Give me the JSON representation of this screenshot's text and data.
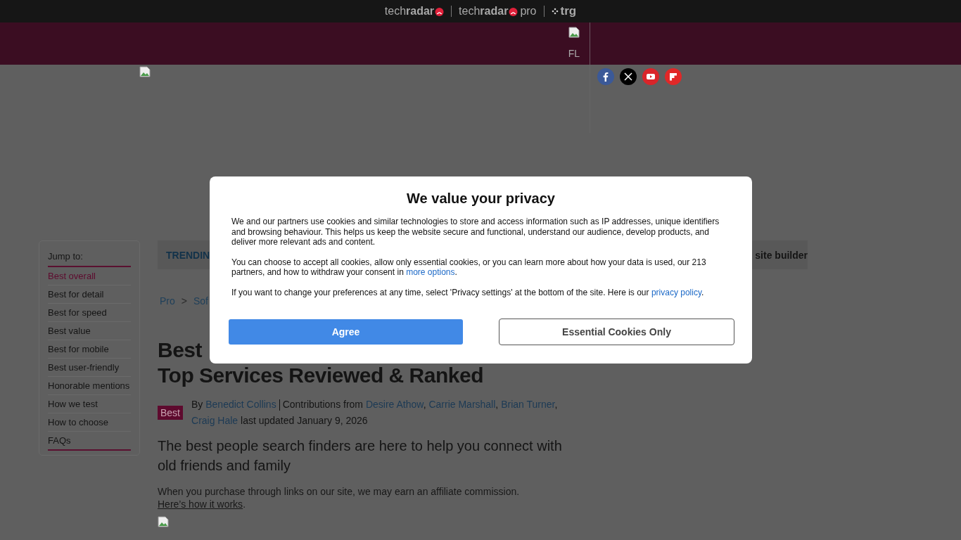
{
  "top_bar": {
    "brands": [
      {
        "kind": "techradar",
        "name": "tech",
        "bold": "radar"
      },
      {
        "kind": "pro",
        "name": "tech",
        "bold": "radar",
        "suffix": "pro"
      },
      {
        "kind": "trg",
        "name": "trg"
      }
    ]
  },
  "header": {
    "image_alt": "FL"
  },
  "social": [
    {
      "kind": "facebook"
    },
    {
      "kind": "x"
    },
    {
      "kind": "youtube"
    },
    {
      "kind": "flipboard"
    }
  ],
  "jump_to": {
    "title": "Jump to:",
    "items": [
      {
        "label": "Best overall",
        "selected": true
      },
      {
        "label": "Best for detail",
        "selected": false
      },
      {
        "label": "Best for speed",
        "selected": false
      },
      {
        "label": "Best value",
        "selected": false
      },
      {
        "label": "Best for mobile",
        "selected": false
      },
      {
        "label": "Best user-friendly",
        "selected": false
      },
      {
        "label": "Honorable mentions",
        "selected": false
      },
      {
        "label": "How we test",
        "selected": false
      },
      {
        "label": "How to choose",
        "selected": false
      },
      {
        "label": "FAQs",
        "selected": false
      }
    ]
  },
  "trending": {
    "label": "TRENDIN",
    "item": "site builder"
  },
  "breadcrumb": [
    "Pro",
    ">",
    "Sof"
  ],
  "article": {
    "title_lines": [
      "Best",
      "Top Services Reviewed & Ranked"
    ],
    "badge": "Best",
    "byline": {
      "by": "By",
      "author": "Benedict Collins",
      "contrib": "Contributions from",
      "contributors": [
        {
          "name": "Desire Athow",
          "sep": ","
        },
        {
          "name": "Carrie Marshall",
          "sep": ","
        },
        {
          "name": "Brian Turner",
          "sep": ","
        },
        {
          "name": "Craig Hale"
        }
      ],
      "updated": "last updated January 9, 2026"
    },
    "standfirst": "The best people search finders are here to help you connect with old friends and family",
    "affiliate": "When you purchase through links on our site, we may earn an affiliate commission.",
    "affiliate_link": "Here’s how it works",
    "affiliate_end": "."
  },
  "privacy": {
    "title": "We value your privacy",
    "paragraphs": [
      {
        "text": "We and our partners use cookies and similar technologies to store and access information such as IP addresses, unique identifiers and browsing behaviour. This helps us keep the website secure and functional, understand our audience, develop products, and deliver more relevant ads and content."
      },
      {
        "text": "You can choose to accept all cookies, allow only essential cookies, or you can learn more about how your data is used, our 213 partners, and how to withdraw your consent in",
        "link": "more options",
        "end": "."
      },
      {
        "text": "If you want to change your preferences at any time, select 'Privacy settings' at the bottom of the site. Here is our",
        "link": "privacy policy",
        "end": "."
      }
    ],
    "buttons": [
      {
        "label": "Agree",
        "kind": "primary"
      },
      {
        "label": "Essential Cookies Only",
        "kind": "secondary"
      }
    ]
  }
}
